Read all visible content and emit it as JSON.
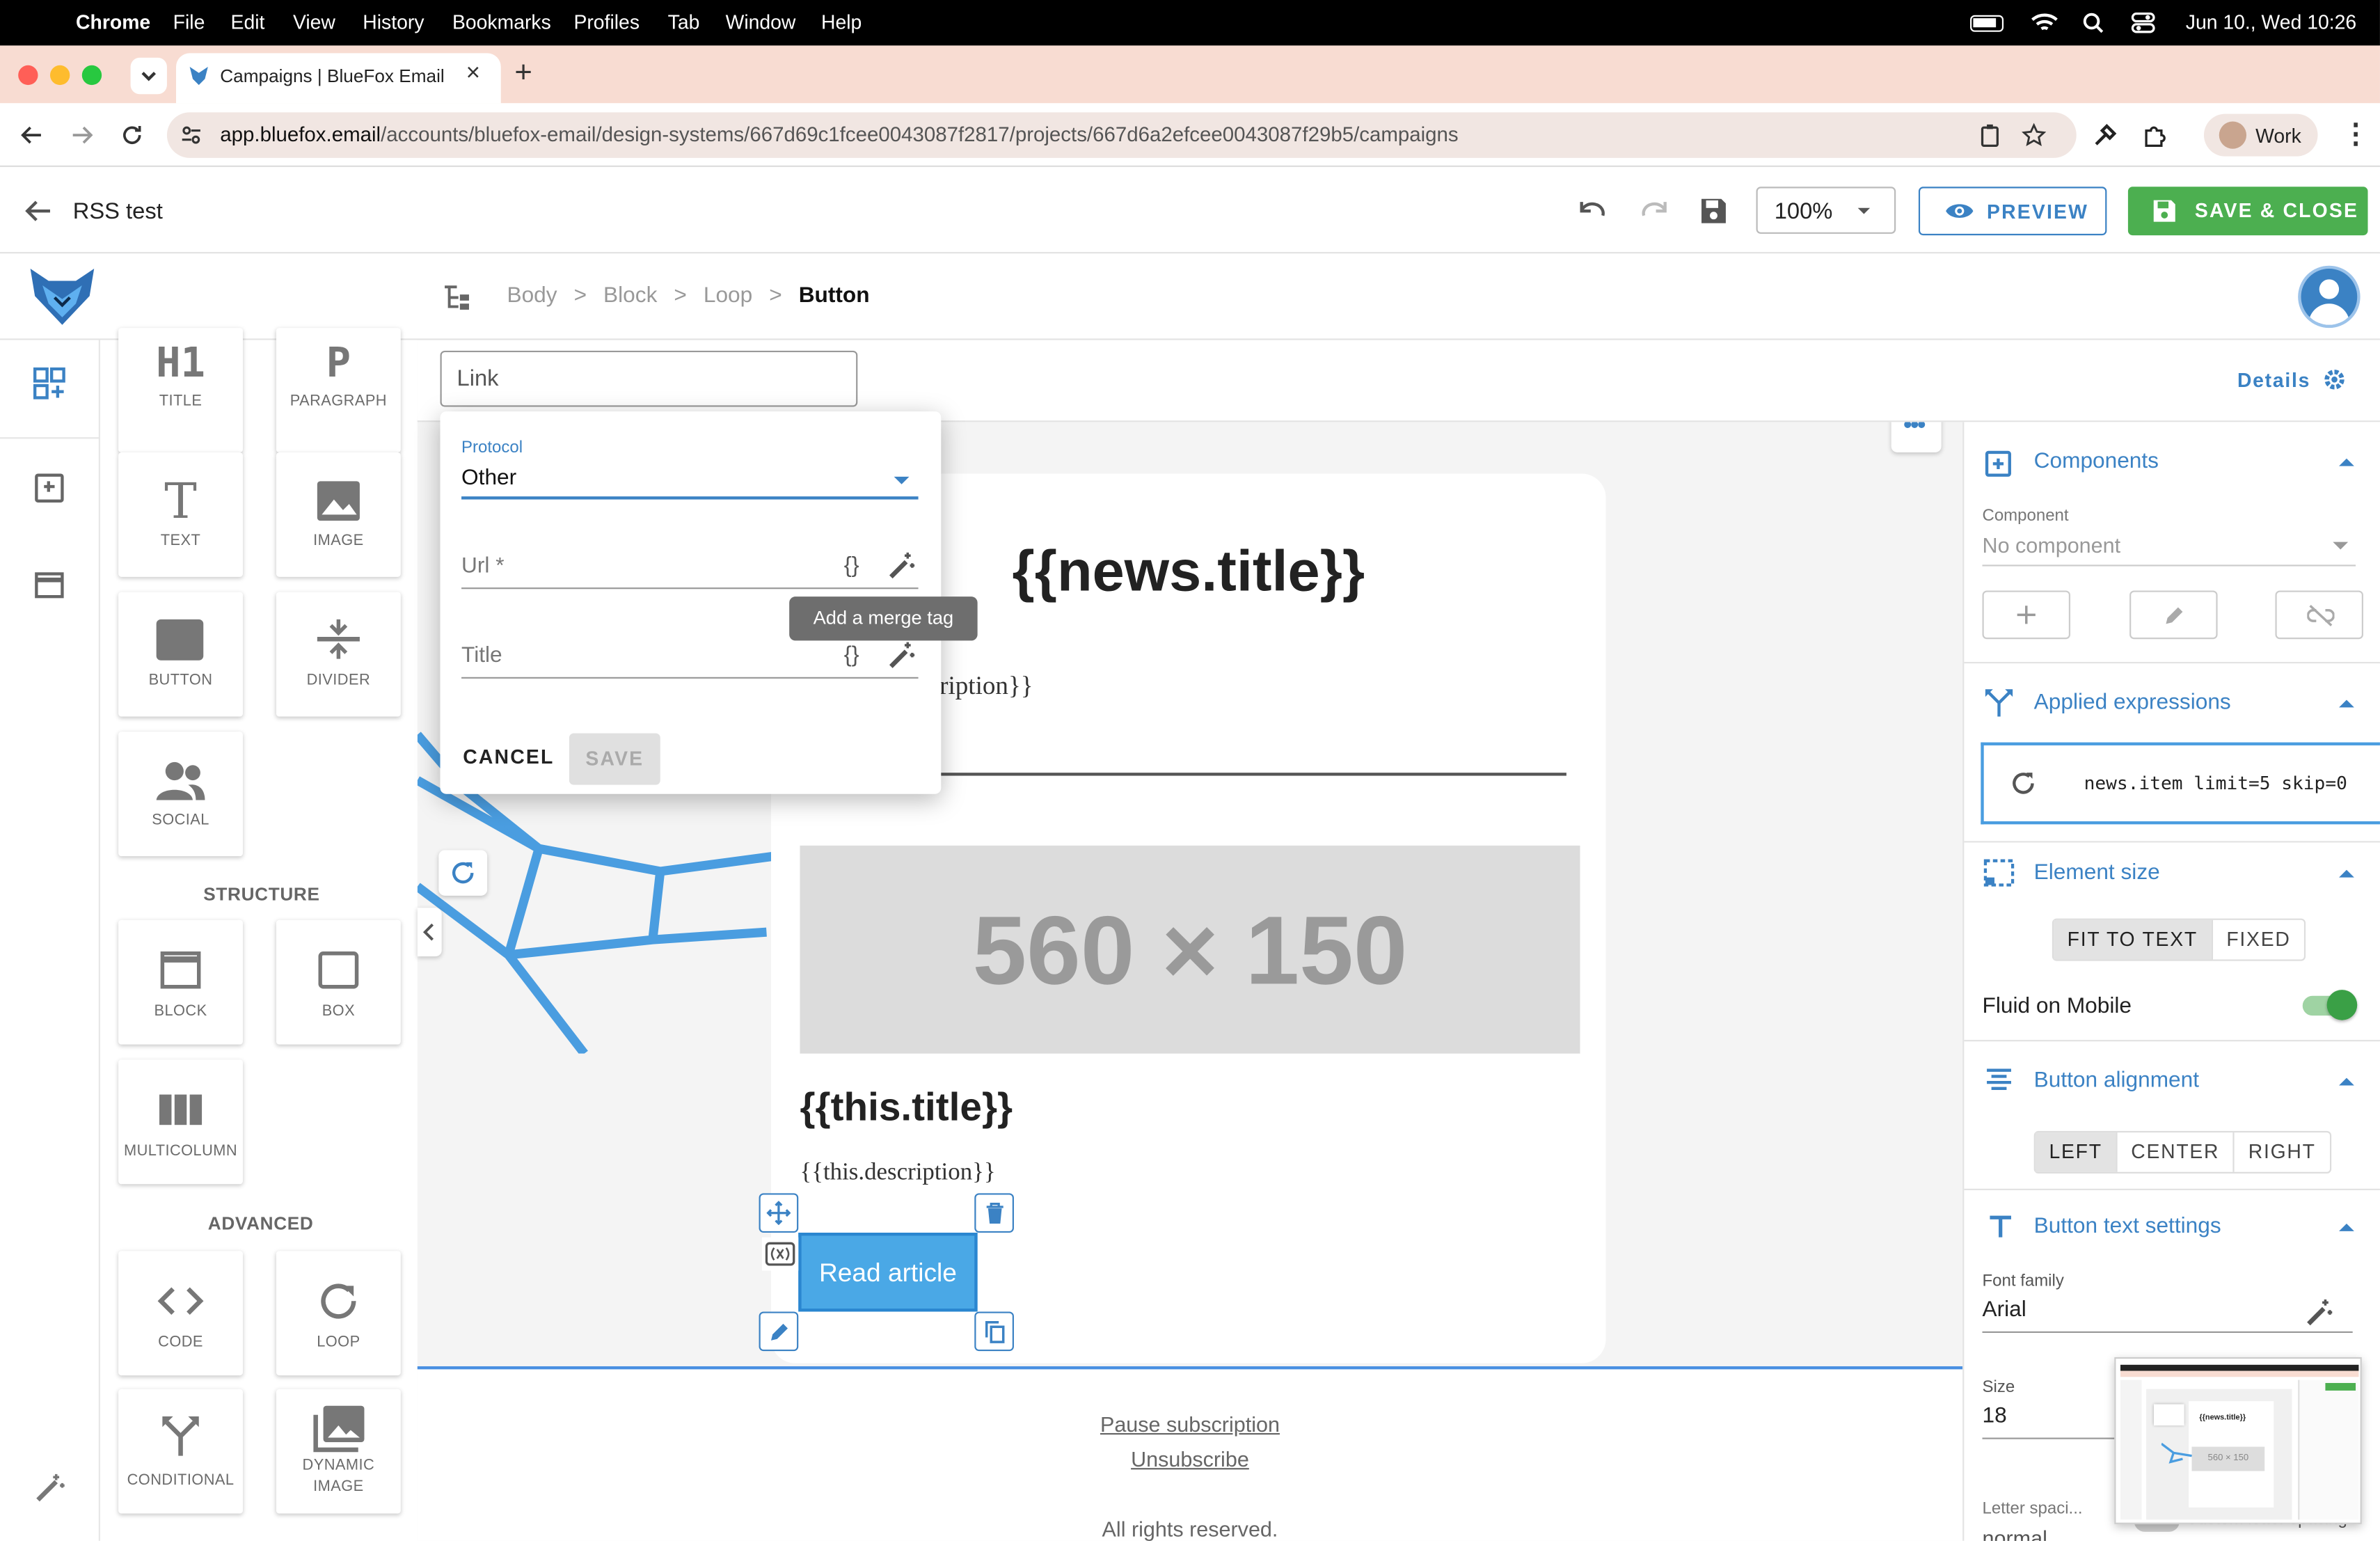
{
  "menubar": {
    "app": "Chrome",
    "items": [
      "File",
      "Edit",
      "View",
      "History",
      "Bookmarks",
      "Profiles",
      "Tab",
      "Window",
      "Help"
    ],
    "clock": "Jun 10., Wed  10:26"
  },
  "browser": {
    "tab_title": "Campaigns | BlueFox Email",
    "url_host": "app.bluefox.email",
    "url_path": "/accounts/bluefox-email/design-systems/667d69c1fcee0043087f2817/projects/667d6a2efcee0043087f29b5/campaigns",
    "profile": "Work"
  },
  "header": {
    "title": "RSS test",
    "zoom": "100%",
    "preview": "PREVIEW",
    "save_close": "SAVE & CLOSE"
  },
  "breadcrumb": [
    "Body",
    "Block",
    "Loop",
    "Button"
  ],
  "palette": {
    "tiles": [
      {
        "glyph": "H1",
        "label": "TITLE"
      },
      {
        "glyph": "P",
        "label": "PARAGRAPH"
      },
      {
        "glyph": "T",
        "label": "TEXT"
      },
      {
        "glyph": "",
        "label": "IMAGE"
      },
      {
        "glyph": "",
        "label": "BUTTON"
      },
      {
        "glyph": "",
        "label": "DIVIDER"
      },
      {
        "glyph": "",
        "label": "SOCIAL"
      },
      {
        "glyph": "",
        "label": "BLOCK"
      },
      {
        "glyph": "",
        "label": "BOX"
      },
      {
        "glyph": "",
        "label": "MULTICOLUMN"
      },
      {
        "glyph": "",
        "label": "CODE"
      },
      {
        "glyph": "",
        "label": "LOOP"
      },
      {
        "glyph": "",
        "label": "CONDITIONAL"
      },
      {
        "glyph": "",
        "label": "DYNAMIC IMAGE"
      }
    ],
    "structure_heading": "STRUCTURE",
    "advanced_heading": "ADVANCED"
  },
  "toolbar": {
    "link_input": "Link",
    "details": "Details"
  },
  "link_popup": {
    "protocol_label": "Protocol",
    "protocol_value": "Other",
    "url_placeholder": "Url *",
    "title_placeholder": "Title",
    "merge_icon": "{}",
    "tooltip": "Add a merge tag",
    "cancel": "CANCEL",
    "save": "SAVE"
  },
  "email": {
    "heading": "{{news.title}}",
    "description_fragment": "ription}}",
    "image_placeholder": "560 × 150",
    "item_title": "{{this.title}}",
    "item_description": "{{this.description}}",
    "button_label": "Read article",
    "footer_links": [
      "Pause subscription",
      "Unsubscribe"
    ],
    "footer_text": "All rights reserved."
  },
  "panel": {
    "components": {
      "heading": "Components",
      "field_label": "Component",
      "field_value": "No component"
    },
    "expressions": {
      "heading": "Applied expressions",
      "value": "news.item limit=5 skip=0"
    },
    "element_size": {
      "heading": "Element size",
      "options": [
        "FIT TO TEXT",
        "FIXED"
      ],
      "selected": "FIT TO TEXT",
      "fluid_label": "Fluid on Mobile",
      "fluid_on": true
    },
    "alignment": {
      "heading": "Button alignment",
      "options": [
        "LEFT",
        "CENTER",
        "RIGHT"
      ],
      "selected": "LEFT"
    },
    "text_settings": {
      "heading": "Button text settings",
      "font_label": "Font family",
      "font_value": "Arial",
      "size_label": "Size",
      "size_value": "18",
      "letter_label": "Letter spaci...",
      "letter_value": "normal",
      "custom_label": "Custom letter spacing"
    }
  },
  "minimap": {
    "heading": "{{news.title}}",
    "image": "560 × 150"
  },
  "colors": {
    "accent": "#3b82c4",
    "save_green": "#4caf50",
    "button_blue": "#4aa8e6",
    "menubar": "#000000",
    "tabstrip": "#f8dcd2"
  }
}
